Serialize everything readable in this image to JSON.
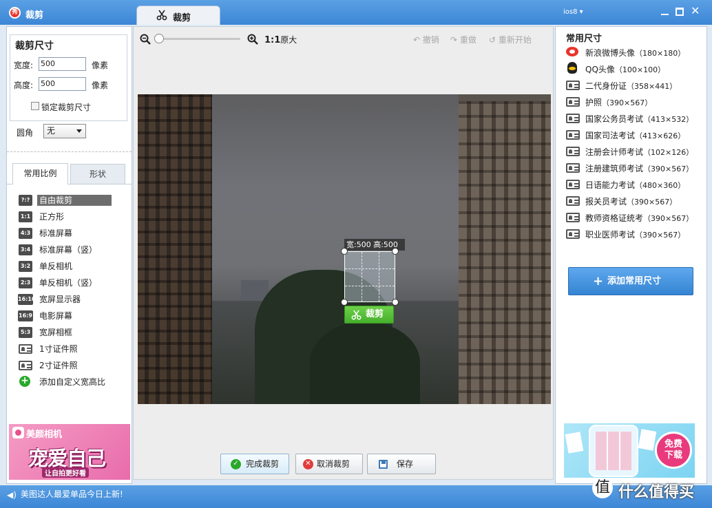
{
  "window": {
    "title": "裁剪",
    "tab_label": "裁剪",
    "user_menu": "ios8 ▾"
  },
  "left": {
    "size_title": "裁剪尺寸",
    "width_label": "宽度:",
    "width_value": "500",
    "height_label": "高度:",
    "height_value": "500",
    "unit": "像素",
    "lock_label": "锁定裁剪尺寸",
    "corner_label": "圆角",
    "corner_value": "无",
    "tab_ratio": "常用比例",
    "tab_shape": "形状",
    "ratios": [
      {
        "badge": "?:?",
        "label": "自由裁剪",
        "icon": "free-crop-icon"
      },
      {
        "badge": "1:1",
        "label": "正方形",
        "icon": "ratio-1-1-icon"
      },
      {
        "badge": "4:3",
        "label": "标准屏幕",
        "icon": "ratio-4-3-icon"
      },
      {
        "badge": "3:4",
        "label": "标准屏幕（竖）",
        "icon": "ratio-3-4-icon"
      },
      {
        "badge": "3:2",
        "label": "单反相机",
        "icon": "ratio-3-2-icon"
      },
      {
        "badge": "2:3",
        "label": "单反相机（竖）",
        "icon": "ratio-2-3-icon"
      },
      {
        "badge": "16:10",
        "label": "宽屏显示器",
        "icon": "ratio-16-10-icon"
      },
      {
        "badge": "16:9",
        "label": "电影屏幕",
        "icon": "ratio-16-9-icon"
      },
      {
        "badge": "5:3",
        "label": "宽屏相框",
        "icon": "ratio-5-3-icon"
      },
      {
        "badge": "",
        "label": "1寸证件照",
        "icon": "id-card-icon"
      },
      {
        "badge": "",
        "label": "2寸证件照",
        "icon": "id-card-icon"
      },
      {
        "badge": "+",
        "label": "添加自定义宽高比",
        "icon": "add-circle-icon"
      }
    ],
    "ad": {
      "brand": "美颜相机",
      "headline": "宠爱自己",
      "slogan": "让自拍更好看"
    }
  },
  "center": {
    "zoom_ratio": "1:1",
    "zoom_ratio_suffix": "原大",
    "undo": "撤销",
    "redo": "重做",
    "restart": "重新开始",
    "crop_size_label": "宽:500 高:500",
    "crop_button": "裁剪",
    "done_button": "完成裁剪",
    "cancel_button": "取消裁剪",
    "save_button": "保存"
  },
  "right": {
    "title": "常用尺寸",
    "presets": [
      {
        "label": "新浪微博头像",
        "size": "（180×180）",
        "icon": "weibo-icon"
      },
      {
        "label": "QQ头像",
        "size": "（100×100）",
        "icon": "qq-icon"
      },
      {
        "label": "二代身份证",
        "size": "（358×441）",
        "icon": "id-card-icon"
      },
      {
        "label": "护照",
        "size": "（390×567）",
        "icon": "id-card-icon"
      },
      {
        "label": "国家公务员考试",
        "size": "（413×532）",
        "icon": "id-card-icon"
      },
      {
        "label": "国家司法考试",
        "size": "（413×626）",
        "icon": "id-card-icon"
      },
      {
        "label": "注册会计师考试",
        "size": "（102×126）",
        "icon": "id-card-icon"
      },
      {
        "label": "注册建筑师考试",
        "size": "（390×567）",
        "icon": "id-card-icon"
      },
      {
        "label": "日语能力考试",
        "size": "（480×360）",
        "icon": "id-card-icon"
      },
      {
        "label": "报关员考试",
        "size": "（390×567）",
        "icon": "id-card-icon"
      },
      {
        "label": "教师资格证统考",
        "size": "（390×567）",
        "icon": "id-card-icon"
      },
      {
        "label": "职业医师考试",
        "size": "（390×567）",
        "icon": "id-card-icon"
      }
    ],
    "add_button": "添加常用尺寸",
    "ad": {
      "badge_line1": "免费",
      "badge_line2": "下载"
    }
  },
  "status": {
    "text": "美图达人最爱单品今日上新!"
  },
  "watermark": {
    "symbol": "值",
    "text": "什么值得买"
  },
  "colors": {
    "titlebar": "#3c86d6",
    "accent_green": "#45b02c",
    "accent_blue": "#3583d2"
  }
}
